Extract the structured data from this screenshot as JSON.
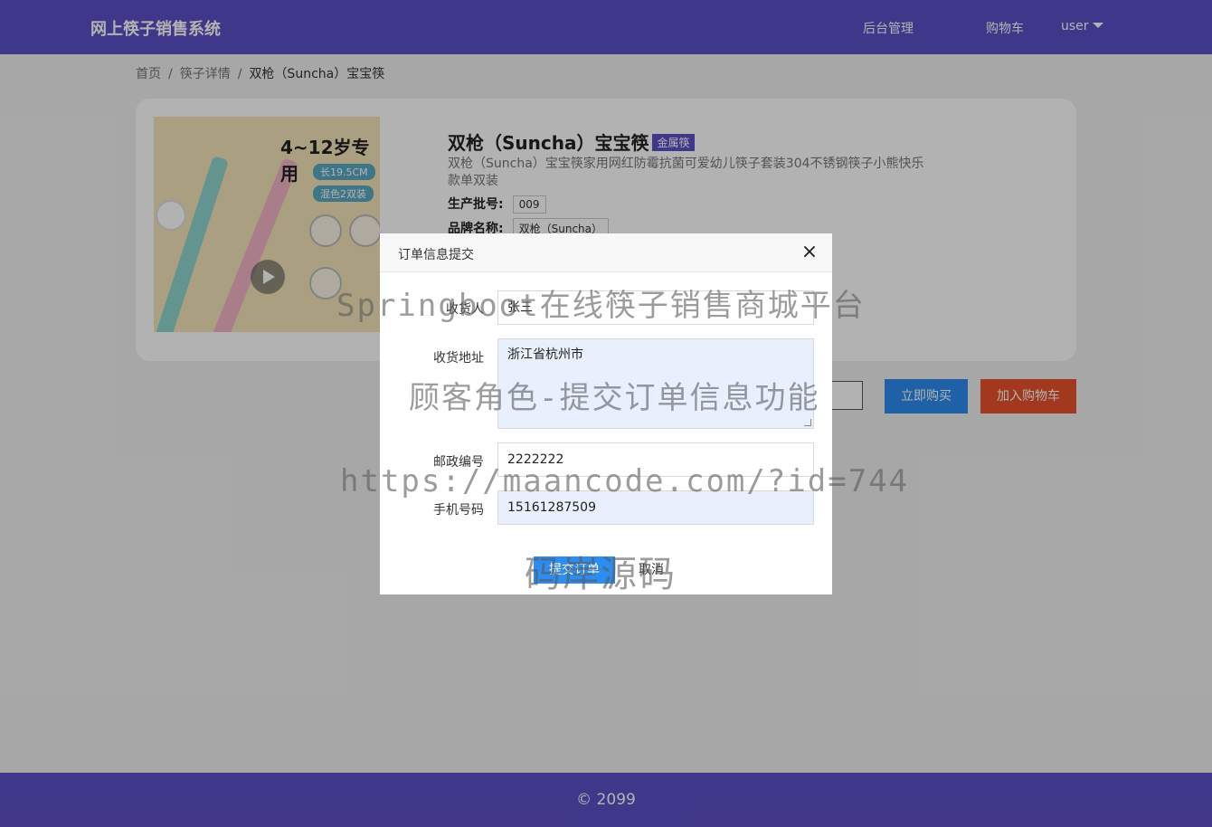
{
  "header": {
    "brand": "网上筷子销售系统",
    "admin_link": "后台管理",
    "cart_link": "购物车",
    "user_menu": "user"
  },
  "breadcrumb": {
    "home": "首页",
    "sep1": "/",
    "detail": "筷子详情",
    "sep2": "/",
    "current": "双枪（Suncha）宝宝筷"
  },
  "product": {
    "title": "双枪（Suncha）宝宝筷",
    "category_badge": "金属筷",
    "description": "双枪（Suncha）宝宝筷家用网红防霉抗菌可爱幼儿筷子套装304不锈钢筷子小熊快乐款单双装",
    "batch_label": "生产批号:",
    "batch_value": "009",
    "brand_label": "品牌名称:",
    "brand_value": "双枪（Suncha）",
    "image": {
      "headline": "4~12岁专用",
      "tag1": "长19.5CM",
      "tag2": "混色2双装"
    }
  },
  "actions": {
    "buy_now": "立即购买",
    "add_to_cart": "加入购物车"
  },
  "modal": {
    "title": "订单信息提交",
    "close_icon": "×",
    "fields": {
      "receiver_label": "收货人",
      "receiver_value": "张三",
      "address_label": "收货地址",
      "address_value": "浙江省杭州市",
      "zip_label": "邮政编号",
      "zip_value": "2222222",
      "phone_label": "手机号码",
      "phone_value": "15161287509"
    },
    "submit": "提交订单",
    "cancel": "取消"
  },
  "watermarks": {
    "line1": "Springboot在线筷子销售商城平台",
    "line2": "顾客角色-提交订单信息功能",
    "line3": "https://maancode.com/?id=744",
    "line4": "码岸源码"
  },
  "footer": {
    "copyright": "© 2099"
  },
  "colors": {
    "primary": "#5b4fc4",
    "buy_button": "#2d8cf0",
    "cart_button": "#e8512a"
  }
}
